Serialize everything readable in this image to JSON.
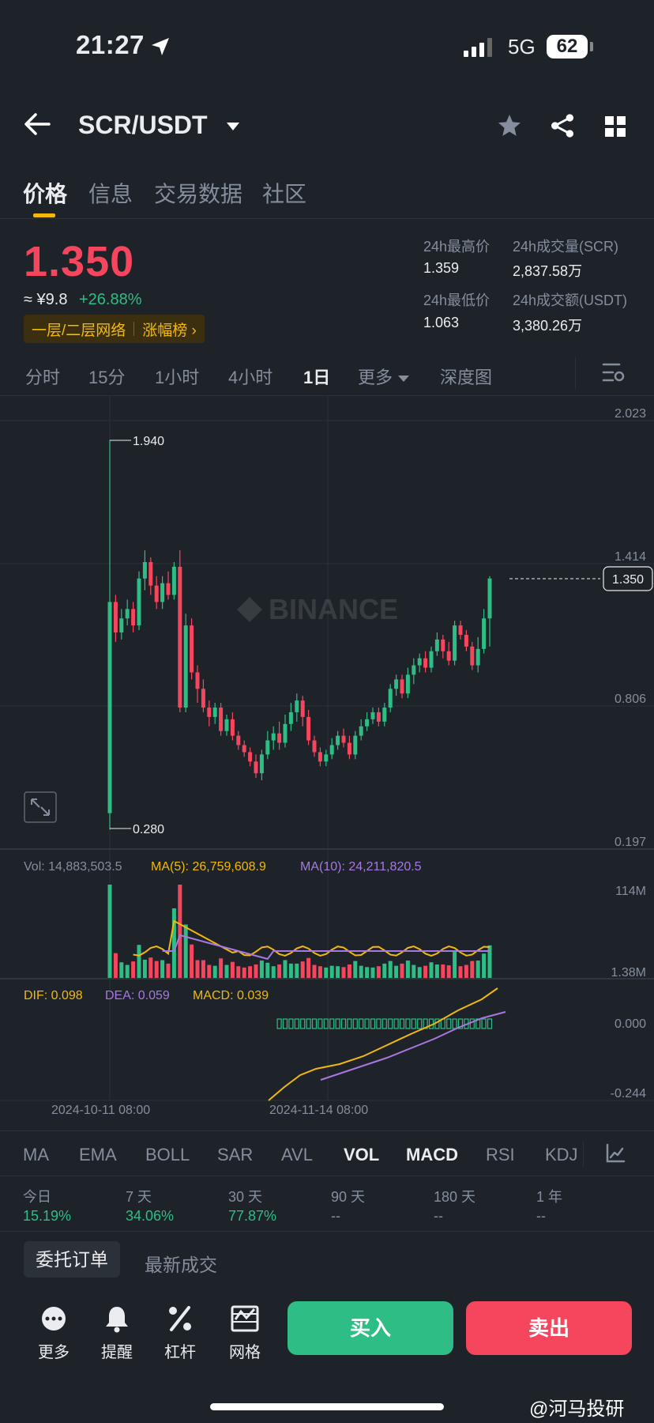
{
  "status_bar": {
    "time": "21:27",
    "network": "5G",
    "battery": "62"
  },
  "header": {
    "pair": "SCR/USDT"
  },
  "tabs": [
    "价格",
    "信息",
    "交易数据",
    "社区"
  ],
  "price": {
    "last": "1.350",
    "cny": "≈ ¥9.8",
    "change": "+26.88%",
    "tag_network": "一层/二层网络",
    "tag_rank": "涨幅榜 ›"
  },
  "stats": {
    "high_label": "24h最高价",
    "high": "1.359",
    "vol_label": "24h成交量(SCR)",
    "vol": "2,837.58万",
    "low_label": "24h最低价",
    "low": "1.063",
    "amount_label": "24h成交额(USDT)",
    "amount": "3,380.26万"
  },
  "intervals": [
    "分时",
    "15分",
    "1小时",
    "4小时",
    "1日",
    "更多",
    "深度图"
  ],
  "active_interval": "1日",
  "chart_data": {
    "type": "candlestick",
    "y_axis_ticks": [
      "2.023",
      "1.414",
      "0.806",
      "0.197"
    ],
    "price_range": [
      0.197,
      2.023
    ],
    "current_price": "1.350",
    "high_marker": "1.940",
    "low_marker": "0.280",
    "x_labels": [
      "2024-10-11 08:00",
      "2024-11-14 08:00"
    ],
    "candles": [
      [
        0.35,
        1.25,
        0.28,
        1.94
      ],
      [
        1.25,
        1.12,
        1.08,
        1.28
      ],
      [
        1.12,
        1.18,
        1.09,
        1.22
      ],
      [
        1.18,
        1.22,
        1.15,
        1.26
      ],
      [
        1.22,
        1.15,
        1.12,
        1.25
      ],
      [
        1.15,
        1.35,
        1.13,
        1.38
      ],
      [
        1.35,
        1.42,
        1.3,
        1.47
      ],
      [
        1.42,
        1.32,
        1.28,
        1.44
      ],
      [
        1.32,
        1.25,
        1.22,
        1.36
      ],
      [
        1.25,
        1.33,
        1.22,
        1.36
      ],
      [
        1.33,
        1.28,
        1.26,
        1.38
      ],
      [
        1.28,
        1.4,
        1.26,
        1.42
      ],
      [
        1.4,
        0.8,
        0.78,
        1.47
      ],
      [
        0.8,
        1.15,
        0.78,
        1.2
      ],
      [
        1.15,
        0.95,
        0.92,
        1.18
      ],
      [
        0.95,
        0.88,
        0.82,
        0.98
      ],
      [
        0.88,
        0.8,
        0.78,
        0.92
      ],
      [
        0.8,
        0.76,
        0.72,
        0.83
      ],
      [
        0.76,
        0.8,
        0.73,
        0.82
      ],
      [
        0.8,
        0.7,
        0.68,
        0.82
      ],
      [
        0.7,
        0.75,
        0.68,
        0.77
      ],
      [
        0.75,
        0.68,
        0.66,
        0.78
      ],
      [
        0.68,
        0.64,
        0.62,
        0.7
      ],
      [
        0.64,
        0.61,
        0.59,
        0.66
      ],
      [
        0.61,
        0.57,
        0.55,
        0.63
      ],
      [
        0.57,
        0.52,
        0.5,
        0.6
      ],
      [
        0.52,
        0.6,
        0.49,
        0.62
      ],
      [
        0.6,
        0.66,
        0.58,
        0.7
      ],
      [
        0.66,
        0.69,
        0.62,
        0.72
      ],
      [
        0.69,
        0.65,
        0.62,
        0.74
      ],
      [
        0.65,
        0.73,
        0.63,
        0.77
      ],
      [
        0.73,
        0.78,
        0.7,
        0.82
      ],
      [
        0.78,
        0.83,
        0.74,
        0.86
      ],
      [
        0.83,
        0.76,
        0.72,
        0.85
      ],
      [
        0.76,
        0.66,
        0.64,
        0.79
      ],
      [
        0.66,
        0.61,
        0.59,
        0.68
      ],
      [
        0.61,
        0.57,
        0.55,
        0.63
      ],
      [
        0.57,
        0.6,
        0.55,
        0.62
      ],
      [
        0.6,
        0.64,
        0.58,
        0.67
      ],
      [
        0.64,
        0.68,
        0.62,
        0.7
      ],
      [
        0.68,
        0.65,
        0.63,
        0.71
      ],
      [
        0.65,
        0.6,
        0.58,
        0.68
      ],
      [
        0.6,
        0.68,
        0.58,
        0.7
      ],
      [
        0.68,
        0.72,
        0.66,
        0.75
      ],
      [
        0.72,
        0.75,
        0.7,
        0.78
      ],
      [
        0.75,
        0.78,
        0.73,
        0.8
      ],
      [
        0.78,
        0.74,
        0.72,
        0.8
      ],
      [
        0.74,
        0.8,
        0.72,
        0.82
      ],
      [
        0.8,
        0.88,
        0.78,
        0.9
      ],
      [
        0.88,
        0.92,
        0.85,
        0.94
      ],
      [
        0.92,
        0.86,
        0.84,
        0.94
      ],
      [
        0.86,
        0.94,
        0.84,
        0.97
      ],
      [
        0.94,
        0.98,
        0.9,
        1.01
      ],
      [
        0.98,
        1.01,
        0.95,
        1.03
      ],
      [
        1.01,
        0.97,
        0.95,
        1.04
      ],
      [
        0.97,
        1.04,
        0.95,
        1.06
      ],
      [
        1.04,
        1.09,
        1.02,
        1.12
      ],
      [
        1.09,
        1.04,
        1.01,
        1.11
      ],
      [
        1.04,
        1.0,
        0.98,
        1.08
      ],
      [
        1.0,
        1.15,
        0.98,
        1.17
      ],
      [
        1.15,
        1.11,
        1.09,
        1.17
      ],
      [
        1.11,
        1.06,
        1.04,
        1.13
      ],
      [
        1.06,
        0.98,
        0.96,
        1.08
      ],
      [
        0.98,
        1.05,
        0.95,
        1.1
      ],
      [
        1.05,
        1.18,
        1.03,
        1.22
      ],
      [
        1.18,
        1.35,
        1.06,
        1.36
      ]
    ],
    "volume_panel": {
      "label_vol": "Vol: 14,883,503.5",
      "label_ma5": "MA(5): 26,759,608.9",
      "label_ma10": "MA(10): 24,211,820.5",
      "ticks": [
        "114M",
        "1.38M"
      ],
      "range": [
        1.38,
        114
      ]
    },
    "macd_panel": {
      "label_dif": "DIF: 0.098",
      "label_dea": "DEA: 0.059",
      "label_macd": "MACD: 0.039",
      "ticks": [
        "0.000",
        "-0.244"
      ]
    }
  },
  "indicators": [
    "MA",
    "EMA",
    "BOLL",
    "SAR",
    "AVL",
    "VOL",
    "MACD",
    "RSI",
    "KDJ"
  ],
  "active_indicators": [
    "VOL",
    "MACD"
  ],
  "performance": {
    "labels": [
      "今日",
      "7 天",
      "30 天",
      "90 天",
      "180 天",
      "1 年"
    ],
    "values": [
      "15.19%",
      "34.06%",
      "77.87%",
      "--",
      "--",
      "--"
    ]
  },
  "order_tabs": {
    "orders": "委托订单",
    "trades": "最新成交"
  },
  "bottom_bar": {
    "more": "更多",
    "alert": "提醒",
    "leverage": "杠杆",
    "grid": "网格",
    "buy": "买入",
    "sell": "卖出"
  },
  "watermark": "@河马投研",
  "colors": {
    "up": "#2ebd85",
    "down": "#f6465d",
    "accent": "#f0b90b",
    "ma10": "#a878e0",
    "background": "#1e2329"
  }
}
